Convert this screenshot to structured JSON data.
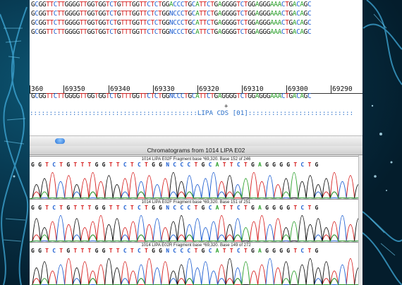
{
  "colors": {
    "A": "#2ca02c",
    "C": "#1f5fd1",
    "G": "#111111",
    "T": "#d62020",
    "N": "#1f5fd1"
  },
  "alignment": {
    "rows": [
      "GCGGTTCTTGGGGTTGGTGGTCTGTTTGGTTCTCTGGACCCTGCATTCTGAGGGGTCTGGAGGGAAACTGACAGC",
      "GCGGTTCTTGGGGTTGGTGGTCTGTTTGGTTCTCTGGNCCCTGCATTCTGAGGGGTCTGGAGGGAAACTGACAGC",
      "GCGGTTCTTGGGGTTGGTGGTCTGTTTGGTTCTCTGGNCCCTGCATTCTGAGGGGTCTGGAGGGAAACTGACAGC",
      "GCGGTTCTTGGGGTTGGTGGTCTGTTTGGTTCTCTGGNCCCTGCATTCTGAGGGGTCTGGAGGGAAACTGACAGC"
    ],
    "consensus": "GCGGTTCTTGGGGTTGGTGGTCTGTTTGGTTCTCTGGNCCCTGCATTCTGAGGGGTCTGGAGGGAAACTGACAGC"
  },
  "ruler": [
    "360",
    "69350",
    "69340",
    "69330",
    "69320",
    "69310",
    "69300",
    "69290"
  ],
  "cursor_mark": "+",
  "cds_track": ":::::::::::::::::::::::::::::::::::::::::::LIPA CDS [01]:::::::::::::::::::::::::::",
  "chromatogram_panel": {
    "title": "Chromatograms from 1014 LIPA E02",
    "traces": [
      {
        "header": "1014 LIPA E02F Fragment base *69,320. Base 152 of 246",
        "bases": "G G T C T G T T T G G T T C T C T G G N C C C T G C A T T C T G A G G G G T C T G"
      },
      {
        "header": "1014 LIPA E02F Fragment base *69,320. Base 151 of 251",
        "bases": "G G T C T G T T T G G T T C T C T G G N C C C T G C A T T C T G A G G G G T C T G"
      },
      {
        "header": "1014 LIPA E02R Fragment base *69,320. Base 149 of 272",
        "bases": "G G T C T G T T T G G T T C T C T G G N C C C T G C A T T C T G A G G G G T C T G"
      }
    ]
  }
}
